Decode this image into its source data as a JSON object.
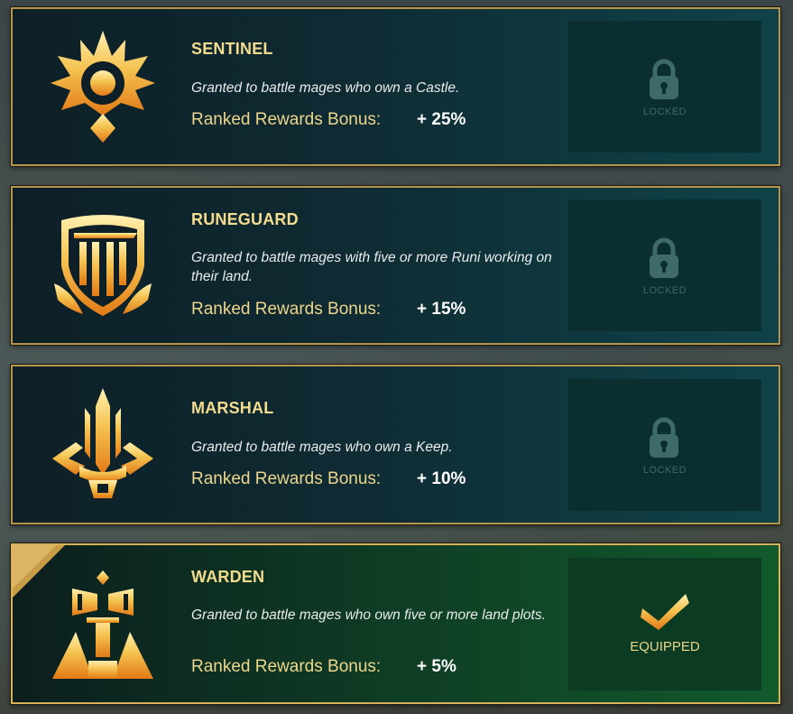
{
  "badges": [
    {
      "title": "SENTINEL",
      "description": "Granted to battle mages who own a Castle.",
      "bonus_label": "Ranked Rewards Bonus:",
      "bonus_value": "+ 25%",
      "status": "LOCKED"
    },
    {
      "title": "RUNEGUARD",
      "description": "Granted to battle mages with five or more Runi working on their land.",
      "bonus_label": "Ranked Rewards Bonus:",
      "bonus_value": "+ 15%",
      "status": "LOCKED"
    },
    {
      "title": "MARSHAL",
      "description": "Granted to battle mages who own a Keep.",
      "bonus_label": "Ranked Rewards Bonus:",
      "bonus_value": "+ 10%",
      "status": "LOCKED"
    },
    {
      "title": "WARDEN",
      "description": "Granted to battle mages who own five or more land plots.",
      "bonus_label": "Ranked Rewards Bonus:",
      "bonus_value": "+ 5%",
      "status": "EQUIPPED"
    }
  ],
  "icons": {
    "sentinel": "sentinel-emblem-icon",
    "runeguard": "runeguard-shield-icon",
    "marshal": "marshal-trident-icon",
    "warden": "warden-hammer-icon",
    "lock": "lock-icon",
    "check": "checkmark-icon"
  },
  "colors": {
    "gold": "#f4dc8f",
    "border": "#b8954c",
    "locked": "#3e6b6a",
    "equipped_bg": "#125a2c"
  }
}
